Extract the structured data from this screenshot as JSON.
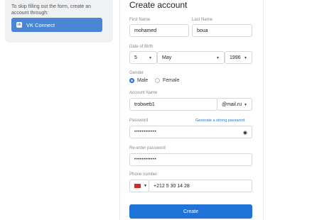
{
  "side": {
    "text": "To skip filling out the form, create an account through:",
    "vk_label": "VK Connect"
  },
  "form": {
    "title": "Create account",
    "first_name_label": "First Name",
    "first_name_value": "mohamed",
    "last_name_label": "Last Name",
    "last_name_value": "boua",
    "dob_label": "Date of Birth",
    "dob_day": "5",
    "dob_month": "May",
    "dob_year": "1996",
    "gender_label": "Gender",
    "gender_male": "Male",
    "gender_female": "Female",
    "account_label": "Account Name",
    "account_value": "trobweb1",
    "domain_value": "@mail.ru",
    "password_label": "Password",
    "generate_link": "Generate a strong password",
    "password_value": "••••••••••••",
    "reenter_label": "Re-enter password",
    "reenter_value": "••••••••••••",
    "phone_label": "Phone number",
    "phone_value": "+212 5 30 14 28",
    "create_label": "Create"
  },
  "colors": {
    "accent": "#1f72d6",
    "vk": "#4a86d3",
    "flag": "#d62b2b"
  }
}
